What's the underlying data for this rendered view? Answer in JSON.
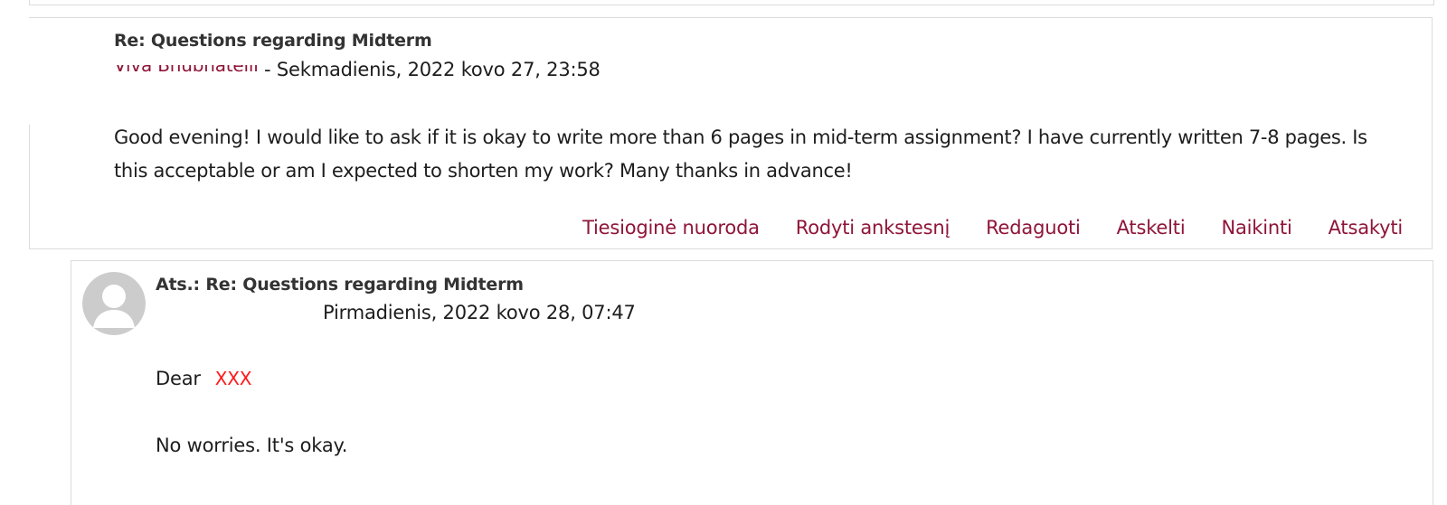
{
  "post1": {
    "subject": "Re: Questions regarding Midterm",
    "author": "Viva Bhubhatelli",
    "byline_sep": " - ",
    "date": "Sekmadienis, 2022 kovo 27, 23:58",
    "message": "Good evening! I would like to ask if it is okay to write more than 6 pages in mid-term assignment? I have currently written 7-8 pages. Is this acceptable or am I expected to shorten my work? Many thanks in advance!",
    "commands": {
      "permalink": "Tiesioginė nuoroda",
      "show_parent": "Rodyti ankstesnį",
      "edit": "Redaguoti",
      "split": "Atskelti",
      "delete": "Naikinti",
      "reply": "Atsakyti"
    }
  },
  "post2": {
    "subject": "Ats.: Re: Questions regarding Midterm",
    "date": "Pirmadienis, 2022 kovo 28, 07:47",
    "greeting": "Dear",
    "greeting_name": "XXX",
    "message": "No worries. It's okay."
  },
  "colors": {
    "link": "#8f1538",
    "border": "#dcdcdc",
    "redacted": "#ff1a1a",
    "avatar": "#cccccc"
  },
  "icons": {
    "avatar": "user-silhouette-icon"
  }
}
